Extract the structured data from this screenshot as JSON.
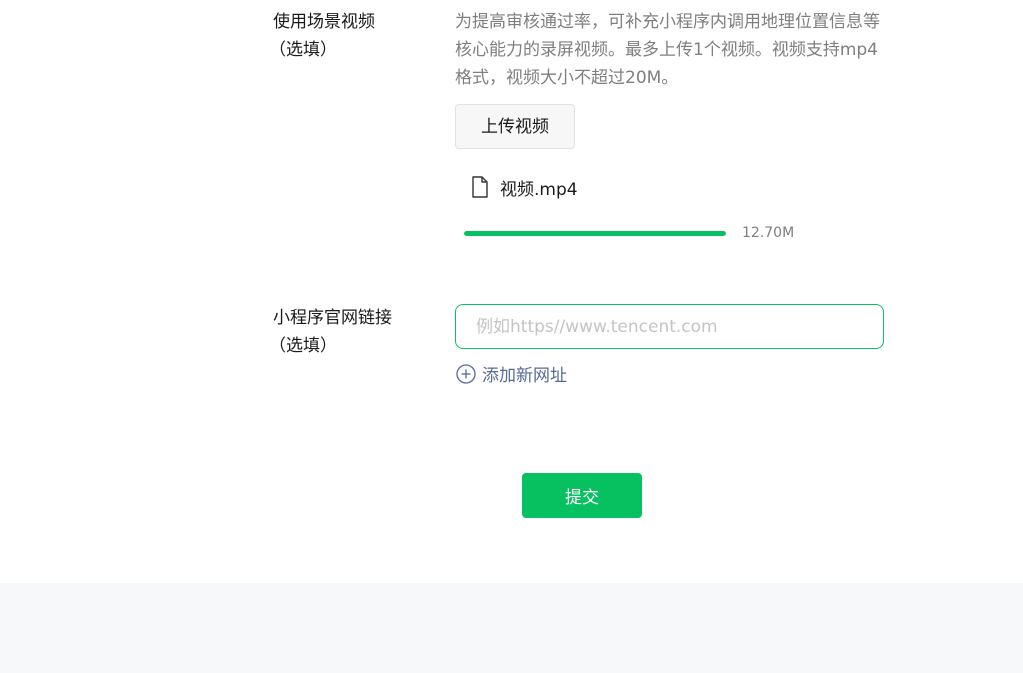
{
  "video_section": {
    "label": "使用场景视频",
    "optional": "（选填）",
    "description": "为提高审核通过率，可补充小程序内调用地理位置信息等核心能力的录屏视频。最多上传1个视频。视频支持mp4格式，视频大小不超过20M。",
    "upload_button": "上传视频",
    "file": {
      "icon": "file-icon",
      "name": "视频.mp4",
      "size": "12.70M",
      "progress_percent": 100
    }
  },
  "link_section": {
    "label": "小程序官网链接",
    "optional": "（选填）",
    "input_value": "",
    "input_placeholder": "例如https//www.tencent.com",
    "add_link": "添加新网址",
    "add_icon": "plus-circle-icon"
  },
  "submit_label": "提交",
  "colors": {
    "accent": "#07c160",
    "link": "#576b95",
    "muted": "#7f7f7f",
    "footer_bg": "#f7f8fa"
  }
}
